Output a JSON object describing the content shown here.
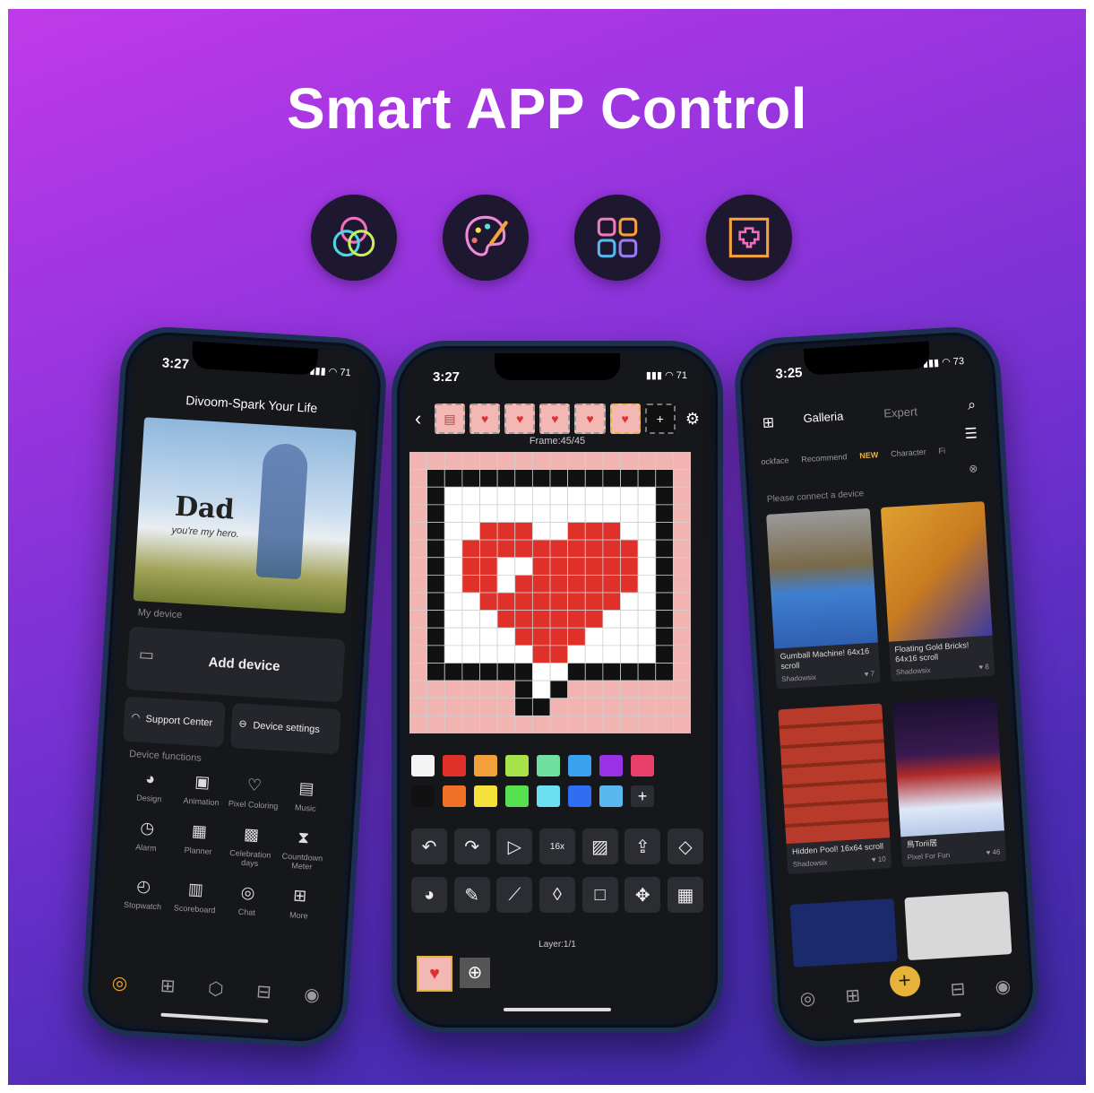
{
  "headline": "Smart APP Control",
  "feature_icons": [
    "color-circles-icon",
    "palette-brush-icon",
    "app-grid-icon",
    "pixel-heart-frame-icon"
  ],
  "colors": {
    "accent": "#e6b23a",
    "brand_purple": "#9a35e0"
  },
  "left_phone": {
    "time": "3:27",
    "battery": "71",
    "app_title": "Divoom-Spark Your Life",
    "banner": {
      "title": "Dad",
      "subtitle": "you're my hero."
    },
    "my_device_label": "My device",
    "add_device_label": "Add device",
    "support_center_label": "Support Center",
    "device_settings_label": "Device settings",
    "device_functions_label": "Device functions",
    "functions": [
      {
        "label": "Design",
        "icon": "palette-icon"
      },
      {
        "label": "Animation",
        "icon": "animation-icon"
      },
      {
        "label": "Pixel Coloring",
        "icon": "bulb-icon"
      },
      {
        "label": "Music",
        "icon": "music-icon"
      },
      {
        "label": "Alarm",
        "icon": "alarm-icon"
      },
      {
        "label": "Planner",
        "icon": "planner-icon"
      },
      {
        "label": "Celebration days",
        "icon": "calendar-icon"
      },
      {
        "label": "Countdown Meter",
        "icon": "hourglass-icon"
      },
      {
        "label": "Stopwatch",
        "icon": "stopwatch-icon"
      },
      {
        "label": "Scoreboard",
        "icon": "scoreboard-icon"
      },
      {
        "label": "Chat",
        "icon": "chat-icon"
      },
      {
        "label": "More",
        "icon": "more-icon"
      }
    ]
  },
  "center_phone": {
    "time": "3:27",
    "battery": "71",
    "frame_label": "Frame:45/45",
    "layer_label": "Layer:1/1",
    "size_label": "16x",
    "palette_row1": [
      "#f4f4f4",
      "#e0302a",
      "#f2a13a",
      "#a6e34a",
      "#6fe0a0",
      "#3aa0f0",
      "#9a30e8",
      "#e8406a"
    ],
    "palette_row2": [
      "#111111",
      "#f07028",
      "#f4e23a",
      "#56e050",
      "#6ae0f0",
      "#2f6ef0",
      "#5ab8f0"
    ]
  },
  "right_phone": {
    "time": "3:25",
    "battery": "73",
    "tab_galleria": "Galleria",
    "tab_expert": "Expert",
    "subtabs": [
      "ockface",
      "Recommend",
      "NEW",
      "Character",
      "Fi"
    ],
    "connect_text": "Please connect a device",
    "tiles": [
      {
        "caption": "Gumball Machine! 64x16 scroll",
        "author": "Shadowsix",
        "likes": "7"
      },
      {
        "caption": "Floating Gold Bricks! 64x16 scroll",
        "author": "Shadowsix",
        "likes": "8"
      },
      {
        "caption": "Hidden Pool! 16x64 scroll",
        "author": "Shadowsix",
        "likes": "10"
      },
      {
        "caption": "鳥Torii居",
        "author": "Pixel For Fun",
        "likes": "46"
      }
    ]
  }
}
